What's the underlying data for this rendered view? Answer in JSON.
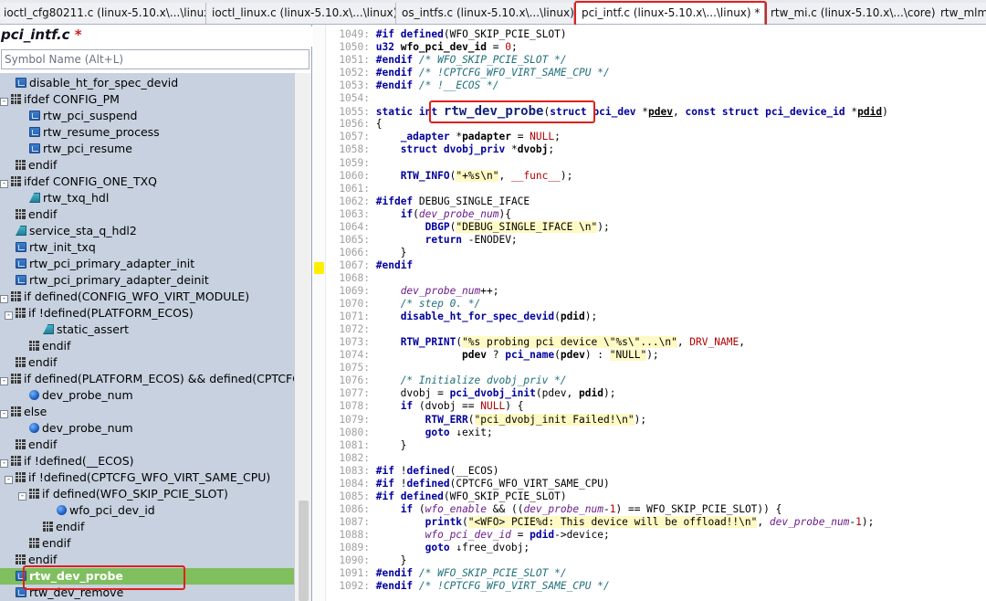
{
  "tabs": [
    {
      "label": "ioctl_cfg80211.c (linux-5.10.x\\...\\linux)",
      "active": false
    },
    {
      "label": "ioctl_linux.c (linux-5.10.x\\...\\linux)",
      "active": false
    },
    {
      "label": "os_intfs.c (linux-5.10.x\\...\\linux)",
      "active": false
    },
    {
      "label": "pci_intf.c (linux-5.10.x\\...\\linux) *",
      "active": true,
      "close": "×"
    },
    {
      "label": "rtw_mi.c (linux-5.10.x\\...\\core)",
      "active": false
    },
    {
      "label": "rtw_mlme.c",
      "active": false
    }
  ],
  "left_panel": {
    "file_title": "pci_intf.c",
    "modified_mark": "*",
    "search_placeholder": "Symbol Name (Alt+L)",
    "tree": [
      {
        "label": "disable_ht_for_spec_devid",
        "icon": "function-icon",
        "level": 1,
        "expander": ""
      },
      {
        "label": "ifdef CONFIG_PM",
        "icon": "ifdef-icon",
        "level": 0,
        "expander": "-"
      },
      {
        "label": "rtw_pci_suspend",
        "icon": "function-icon",
        "level": 2,
        "expander": ""
      },
      {
        "label": "rtw_resume_process",
        "icon": "function-icon",
        "level": 2,
        "expander": ""
      },
      {
        "label": "rtw_pci_resume",
        "icon": "function-icon",
        "level": 2,
        "expander": ""
      },
      {
        "label": "endif",
        "icon": "ifdef-icon",
        "level": 1,
        "expander": ""
      },
      {
        "label": "ifdef CONFIG_ONE_TXQ",
        "icon": "ifdef-icon",
        "level": 0,
        "expander": "-"
      },
      {
        "label": "rtw_txq_hdl",
        "icon": "type-icon",
        "level": 2,
        "expander": ""
      },
      {
        "label": "endif",
        "icon": "ifdef-icon",
        "level": 1,
        "expander": ""
      },
      {
        "label": "service_sta_q_hdl2",
        "icon": "type-icon",
        "level": 1,
        "expander": ""
      },
      {
        "label": "rtw_init_txq",
        "icon": "function-icon",
        "level": 1,
        "expander": ""
      },
      {
        "label": "rtw_pci_primary_adapter_init",
        "icon": "function-icon",
        "level": 1,
        "expander": ""
      },
      {
        "label": "rtw_pci_primary_adapter_deinit",
        "icon": "function-icon",
        "level": 1,
        "expander": ""
      },
      {
        "label": "if defined(CONFIG_WFO_VIRT_MODULE)",
        "icon": "ifdef-icon",
        "level": 0,
        "expander": "-"
      },
      {
        "label": "if !defined(PLATFORM_ECOS)",
        "icon": "ifdef-icon",
        "level": 1,
        "expander": "-"
      },
      {
        "label": "static_assert",
        "icon": "type-icon",
        "level": 3,
        "expander": ""
      },
      {
        "label": "endif",
        "icon": "ifdef-icon",
        "level": 2,
        "expander": ""
      },
      {
        "label": "endif",
        "icon": "ifdef-icon",
        "level": 1,
        "expander": ""
      },
      {
        "label": "if defined(PLATFORM_ECOS) && defined(CPTCFG_WFO_VIRT_SAME_CPU)",
        "icon": "ifdef-icon",
        "level": 0,
        "expander": "-"
      },
      {
        "label": "dev_probe_num",
        "icon": "variable-icon",
        "level": 2,
        "expander": ""
      },
      {
        "label": "else",
        "icon": "ifdef-icon",
        "level": 0,
        "expander": "-"
      },
      {
        "label": "dev_probe_num",
        "icon": "variable-icon",
        "level": 2,
        "expander": ""
      },
      {
        "label": "endif",
        "icon": "ifdef-icon",
        "level": 1,
        "expander": ""
      },
      {
        "label": "if !defined(__ECOS)",
        "icon": "ifdef-icon",
        "level": 0,
        "expander": "-"
      },
      {
        "label": "if !defined(CPTCFG_WFO_VIRT_SAME_CPU)",
        "icon": "ifdef-icon",
        "level": 1,
        "expander": "-"
      },
      {
        "label": "if defined(WFO_SKIP_PCIE_SLOT)",
        "icon": "ifdef-icon",
        "level": 2,
        "expander": "-"
      },
      {
        "label": "wfo_pci_dev_id",
        "icon": "variable-icon",
        "level": 4,
        "expander": ""
      },
      {
        "label": "endif",
        "icon": "ifdef-icon",
        "level": 3,
        "expander": ""
      },
      {
        "label": "endif",
        "icon": "ifdef-icon",
        "level": 2,
        "expander": ""
      },
      {
        "label": "endif",
        "icon": "ifdef-icon",
        "level": 1,
        "expander": ""
      },
      {
        "label": "rtw_dev_probe",
        "icon": "function-icon",
        "level": 1,
        "expander": "",
        "selected": true
      },
      {
        "label": "rtw_dev_remove",
        "icon": "function-icon",
        "level": 1,
        "expander": ""
      }
    ]
  },
  "editor": {
    "lines": [
      {
        "n": "1049:",
        "html": "<span class='pp'>#if</span> <span class='kw'>defined</span>(WFO_SKIP_PCIE_SLOT)"
      },
      {
        "n": "1050:",
        "html": "<span class='kw'>u32</span> <b>wfo_pci_dev_id</b> = <span class='mac'>0</span>;"
      },
      {
        "n": "1051:",
        "html": "<span class='pp'>#endif</span> <span class='cm'>/* WFO_SKIP_PCIE_SLOT */</span>"
      },
      {
        "n": "1052:",
        "html": "<span class='pp'>#endif</span> <span class='cm'>/* !CPTCFG_WFO_VIRT_SAME_CPU */</span>"
      },
      {
        "n": "1053:",
        "html": "<span class='pp'>#endif</span> <span class='cm'>/* !__ECOS */</span>"
      },
      {
        "n": "1054:",
        "html": ""
      },
      {
        "n": "1055:",
        "html": "<span class='kw'>static</span> <span class='kw'>int</span> <span class='def'>rtw_dev_probe</span>(<span class='kw'>struct</span> <span class='kw'>pci_dev</span> *<b class='ul'>pdev</b>, <span class='kw'>const</span> <span class='kw'>struct</span> <span class='kw'>pci_device_id</span> *<b class='ul'>pdid</b>)"
      },
      {
        "n": "1056:",
        "html": "{"
      },
      {
        "n": "1057:",
        "html": "    <span class='kw'>_adapter</span> *<b>padapter</b> = <span class='mac'>NULL</span>;"
      },
      {
        "n": "1058:",
        "html": "    <span class='kw'>struct</span> <span class='kw'>dvobj_priv</span> *<b>dvobj</b>;"
      },
      {
        "n": "1059:",
        "html": ""
      },
      {
        "n": "1060:",
        "html": "    <span class='fn'>RTW_INFO</span>(<span class='str'>\"+%s\\n\"</span>, <span class='mac'>__func__</span>);"
      },
      {
        "n": "1061:",
        "html": ""
      },
      {
        "n": "1062:",
        "html": "<span class='pp'>#ifdef</span> DEBUG_SINGLE_IFACE"
      },
      {
        "n": "1063:",
        "html": "    <span class='kw'>if</span>(<span class='it'>dev_probe_num</span>){"
      },
      {
        "n": "1064:",
        "html": "        <span class='fn'>DBGP</span>(<span class='str'>\"DEBUG_SINGLE_IFACE \\n\"</span>);"
      },
      {
        "n": "1065:",
        "html": "        <span class='kw'>return</span> -ENODEV;"
      },
      {
        "n": "1066:",
        "html": "    }"
      },
      {
        "n": "1067:",
        "html": "<span class='pp'>#endif</span>"
      },
      {
        "n": "1068:",
        "html": ""
      },
      {
        "n": "1069:",
        "html": "    <span class='it'>dev_probe_num</span>++;"
      },
      {
        "n": "1070:",
        "html": "    <span class='cm'>/* step 0. */</span>"
      },
      {
        "n": "1071:",
        "html": "    <span class='fn'>disable_ht_for_spec_devid</span>(<b>pdid</b>);"
      },
      {
        "n": "1072:",
        "html": ""
      },
      {
        "n": "1073:",
        "html": "    <span class='fn'>RTW_PRINT</span>(<span class='str'>\"%s probing pci device \\\"%s\\\"...\\n\"</span>, <span class='mac'>DRV_NAME</span>,"
      },
      {
        "n": "1074:",
        "html": "              <b>pdev</b> ? <span class='fn'>pci_name</span>(<b>pdev</b>) : <span class='str'>\"NULL\"</span>);"
      },
      {
        "n": "1075:",
        "html": ""
      },
      {
        "n": "1076:",
        "html": "    <span class='cm'>/* Initialize dvobj_priv */</span>"
      },
      {
        "n": "1077:",
        "html": "    dvobj = <span class='fn'>pci_dvobj_init</span>(pdev, <b>pdid</b>);"
      },
      {
        "n": "1078:",
        "html": "    <span class='kw'>if</span> (dvobj == <span class='mac'>NULL</span>) {"
      },
      {
        "n": "1079:",
        "html": "        <span class='fn'>RTW_ERR</span>(<span class='str'>\"pci_dvobj_init Failed!\\n\"</span>);"
      },
      {
        "n": "1080:",
        "html": "        <span class='kw'>goto</span> ↓exit;"
      },
      {
        "n": "1081:",
        "html": "    }"
      },
      {
        "n": "1082:",
        "html": ""
      },
      {
        "n": "1083:",
        "html": "<span class='pp'>#if</span> !<span class='kw'>defined</span>(__ECOS)"
      },
      {
        "n": "1084:",
        "html": "<span class='pp'>#if</span> !<span class='kw'>defined</span>(CPTCFG_WFO_VIRT_SAME_CPU)"
      },
      {
        "n": "1085:",
        "html": "<span class='pp'>#if</span> <span class='kw'>defined</span>(WFO_SKIP_PCIE_SLOT)"
      },
      {
        "n": "1086:",
        "html": "    <span class='kw'>if</span> (<span class='it'>wfo_enable</span> &amp;&amp; ((<span class='it'>dev_probe_num</span>-<span class='mac'>1</span>) == WFO_SKIP_PCIE_SLOT)) {"
      },
      {
        "n": "1087:",
        "html": "        <span class='fn'>printk</span>(<span class='str'>\"&lt;WFO&gt; PCIE%d: This device will be offload!!\\n\"</span>, <span class='it'>dev_probe_num</span>-<span class='mac'>1</span>);"
      },
      {
        "n": "1088:",
        "html": "        <span class='it'>wfo_pci_dev_id</span> = <span class='fn'>pdid</span>->device;"
      },
      {
        "n": "1089:",
        "html": "        <span class='kw'>goto</span> ↓free_dvobj;"
      },
      {
        "n": "1090:",
        "html": "    }"
      },
      {
        "n": "1091:",
        "html": "<span class='pp'>#endif</span> <span class='cm'>/* WFO_SKIP_PCIE_SLOT */</span>"
      },
      {
        "n": "1092:",
        "html": "<span class='pp'>#endif</span> <span class='cm'>/* !CPTCFG_WFO_VIRT_SAME_CPU */</span>"
      }
    ]
  }
}
